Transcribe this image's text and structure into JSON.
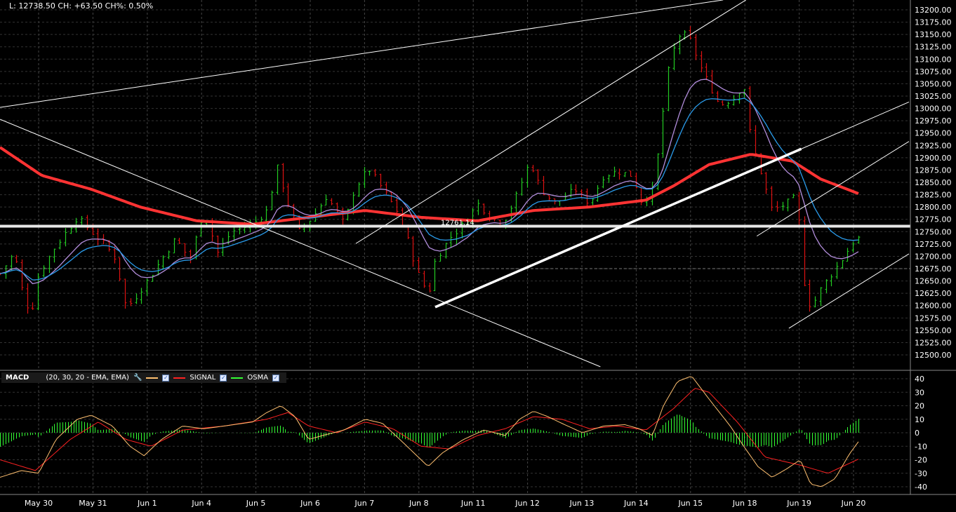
{
  "header": {
    "info": "L: 12738.50 CH: +63.50 CH%: 0.50%"
  },
  "macd_legend": {
    "title": "MACD",
    "params": "(20, 30, 20 - EMA, EMA)",
    "signal_label": "SIGNAL",
    "osma_label": "OSMA",
    "checked": "✓"
  },
  "colors": {
    "background": "#000000",
    "up": "#22cc22",
    "down": "#dd1111",
    "ma_long": "#ff3333",
    "ma_fast": "#b28ddb",
    "ma_slow": "#2a9bea",
    "macd": "#ffc070",
    "signal": "#ff2222",
    "osma": "#33ff33",
    "trendline": "#ffffff"
  },
  "chart_data": [
    {
      "type": "candlestick",
      "x_tick_labels": [
        "May 30",
        "May 31",
        "Jun 1",
        "Jun 4",
        "Jun 5",
        "Jun 6",
        "Jun 7",
        "Jun 8",
        "Jun 11",
        "Jun 12",
        "Jun 13",
        "Jun 14",
        "Jun 15",
        "Jun 18",
        "Jun 19",
        "Jun 20"
      ],
      "y_tick_labels": [
        "13200.00",
        "13175.00",
        "13150.00",
        "13125.00",
        "13100.00",
        "13075.00",
        "13050.00",
        "13025.00",
        "13000.00",
        "12975.00",
        "12950.00",
        "12925.00",
        "12900.00",
        "12875.00",
        "12850.00",
        "12825.00",
        "12800.00",
        "12775.00",
        "12750.00",
        "12725.00",
        "12700.00",
        "12675.00",
        "12650.00",
        "12625.00",
        "12600.00",
        "12575.00",
        "12550.00",
        "12525.00",
        "12500.00"
      ],
      "ylim": [
        12490,
        13220
      ],
      "close_path": [
        [
          -0.71,
          12665
        ],
        [
          -0.45,
          12708
        ],
        [
          -0.26,
          12608
        ],
        [
          -0.13,
          12587
        ],
        [
          0,
          12665
        ],
        [
          0.32,
          12722
        ],
        [
          0.71,
          12779
        ],
        [
          0.97,
          12750
        ],
        [
          1.23,
          12722
        ],
        [
          1.42,
          12694
        ],
        [
          1.61,
          12594
        ],
        [
          1.81,
          12622
        ],
        [
          2.0,
          12651
        ],
        [
          2.26,
          12694
        ],
        [
          2.52,
          12736
        ],
        [
          2.78,
          12694
        ],
        [
          3.04,
          12793
        ],
        [
          3.29,
          12708
        ],
        [
          3.55,
          12750
        ],
        [
          3.94,
          12765
        ],
        [
          4.2,
          12793
        ],
        [
          4.39,
          12879
        ],
        [
          4.59,
          12807
        ],
        [
          4.78,
          12750
        ],
        [
          5.04,
          12779
        ],
        [
          5.3,
          12822
        ],
        [
          5.62,
          12765
        ],
        [
          5.81,
          12836
        ],
        [
          6.07,
          12879
        ],
        [
          6.33,
          12836
        ],
        [
          6.59,
          12793
        ],
        [
          6.78,
          12736
        ],
        [
          6.98,
          12665
        ],
        [
          7.17,
          12622
        ],
        [
          7.3,
          12694
        ],
        [
          7.56,
          12736
        ],
        [
          7.82,
          12765
        ],
        [
          8.08,
          12807
        ],
        [
          8.33,
          12779
        ],
        [
          8.53,
          12765
        ],
        [
          8.79,
          12822
        ],
        [
          9.04,
          12893
        ],
        [
          9.24,
          12836
        ],
        [
          9.5,
          12807
        ],
        [
          9.88,
          12836
        ],
        [
          10.14,
          12807
        ],
        [
          10.4,
          12864
        ],
        [
          10.66,
          12872
        ],
        [
          10.92,
          12864
        ],
        [
          11.11,
          12807
        ],
        [
          11.3,
          12836
        ],
        [
          11.43,
          12935
        ],
        [
          11.56,
          13063
        ],
        [
          11.69,
          13120
        ],
        [
          11.82,
          13156
        ],
        [
          12.02,
          13135
        ],
        [
          12.14,
          13092
        ],
        [
          12.34,
          13049
        ],
        [
          12.53,
          13006
        ],
        [
          12.79,
          13021
        ],
        [
          12.98,
          13049
        ],
        [
          13.11,
          12935
        ],
        [
          13.31,
          12864
        ],
        [
          13.5,
          12793
        ],
        [
          13.76,
          12807
        ],
        [
          13.95,
          12822
        ],
        [
          14.08,
          12651
        ],
        [
          14.21,
          12594
        ],
        [
          14.41,
          12637
        ],
        [
          14.6,
          12665
        ],
        [
          14.79,
          12694
        ],
        [
          14.99,
          12729
        ],
        [
          15.12,
          12739
        ]
      ],
      "ma_long_path": [
        [
          -0.71,
          12921
        ],
        [
          0.06,
          12864
        ],
        [
          0.97,
          12836
        ],
        [
          1.87,
          12800
        ],
        [
          2.91,
          12772
        ],
        [
          3.94,
          12765
        ],
        [
          4.97,
          12779
        ],
        [
          6.01,
          12793
        ],
        [
          7.04,
          12779
        ],
        [
          8.08,
          12772
        ],
        [
          9.11,
          12793
        ],
        [
          10.14,
          12800
        ],
        [
          11.18,
          12814
        ],
        [
          11.69,
          12843
        ],
        [
          12.34,
          12886
        ],
        [
          13.11,
          12907
        ],
        [
          13.88,
          12893
        ],
        [
          14.39,
          12857
        ],
        [
          15.12,
          12826
        ]
      ],
      "horizontal_line": {
        "price": 12761.14,
        "label": "12761.14"
      },
      "reference_line": 12675,
      "trendlines": [
        {
          "from": [
            -0.71,
            13002
          ],
          "to": [
            12.6,
            13220
          ],
          "weight": "thin"
        },
        {
          "from": [
            -0.71,
            12978
          ],
          "to": [
            10.34,
            12476
          ],
          "weight": "thin"
        },
        {
          "from": [
            5.84,
            12726
          ],
          "to": [
            13.02,
            13220
          ],
          "weight": "thin"
        },
        {
          "from": [
            7.3,
            12597
          ],
          "to": [
            14.04,
            12918
          ],
          "weight": "thick"
        },
        {
          "from": [
            14.04,
            12918
          ],
          "to": [
            16.02,
            13013
          ],
          "weight": "thin"
        },
        {
          "from": [
            13.22,
            12741
          ],
          "to": [
            16.02,
            12933
          ],
          "weight": "thin"
        },
        {
          "from": [
            13.81,
            12554
          ],
          "to": [
            16.02,
            12705
          ],
          "weight": "thin"
        }
      ]
    },
    {
      "type": "line",
      "series_names": [
        "MACD",
        "SIGNAL",
        "OSMA"
      ],
      "y_tick_labels": [
        "40",
        "30",
        "20",
        "10",
        "0",
        "-10",
        "-20",
        "-30",
        "-40"
      ],
      "ylim": [
        -45,
        45
      ],
      "macd_path": [
        [
          -0.71,
          -33
        ],
        [
          -0.32,
          -28
        ],
        [
          0,
          -30
        ],
        [
          0.32,
          -5
        ],
        [
          0.71,
          10
        ],
        [
          0.97,
          13
        ],
        [
          1.36,
          5
        ],
        [
          1.68,
          -10
        ],
        [
          1.94,
          -17
        ],
        [
          2.26,
          -5
        ],
        [
          2.65,
          5
        ],
        [
          3.04,
          3
        ],
        [
          3.42,
          5
        ],
        [
          3.94,
          8
        ],
        [
          4.2,
          15
        ],
        [
          4.46,
          20
        ],
        [
          4.72,
          12
        ],
        [
          4.97,
          -5
        ],
        [
          5.23,
          -2
        ],
        [
          5.62,
          2
        ],
        [
          6.01,
          10
        ],
        [
          6.33,
          7
        ],
        [
          6.65,
          -5
        ],
        [
          6.91,
          -15
        ],
        [
          7.17,
          -25
        ],
        [
          7.43,
          -15
        ],
        [
          7.82,
          -5
        ],
        [
          8.2,
          2
        ],
        [
          8.59,
          -2
        ],
        [
          8.85,
          10
        ],
        [
          9.11,
          16
        ],
        [
          9.37,
          12
        ],
        [
          9.63,
          7
        ],
        [
          10.01,
          0
        ],
        [
          10.4,
          5
        ],
        [
          10.79,
          6
        ],
        [
          11.05,
          3
        ],
        [
          11.3,
          -2
        ],
        [
          11.5,
          20
        ],
        [
          11.76,
          38
        ],
        [
          12.02,
          42
        ],
        [
          12.34,
          25
        ],
        [
          12.73,
          5
        ],
        [
          12.98,
          -10
        ],
        [
          13.24,
          -25
        ],
        [
          13.5,
          -33
        ],
        [
          13.76,
          -27
        ],
        [
          14.02,
          -20
        ],
        [
          14.21,
          -38
        ],
        [
          14.41,
          -40
        ],
        [
          14.66,
          -34
        ],
        [
          14.92,
          -16
        ],
        [
          15.12,
          -5
        ]
      ],
      "signal_path": [
        [
          -0.71,
          -20
        ],
        [
          -0.06,
          -28
        ],
        [
          0.58,
          -5
        ],
        [
          1.1,
          8
        ],
        [
          1.61,
          -5
        ],
        [
          2.07,
          -10
        ],
        [
          2.65,
          2
        ],
        [
          3.42,
          5
        ],
        [
          4.2,
          10
        ],
        [
          4.59,
          15
        ],
        [
          4.97,
          5
        ],
        [
          5.49,
          0
        ],
        [
          6.01,
          8
        ],
        [
          6.52,
          3
        ],
        [
          7.04,
          -10
        ],
        [
          7.56,
          -12
        ],
        [
          8.08,
          -2
        ],
        [
          8.59,
          3
        ],
        [
          9.11,
          12
        ],
        [
          9.63,
          10
        ],
        [
          10.14,
          3
        ],
        [
          10.66,
          5
        ],
        [
          11.18,
          2
        ],
        [
          11.69,
          18
        ],
        [
          12.08,
          33
        ],
        [
          12.34,
          30
        ],
        [
          12.86,
          8
        ],
        [
          13.37,
          -18
        ],
        [
          14.02,
          -24
        ],
        [
          14.53,
          -30
        ],
        [
          15.12,
          -19
        ]
      ]
    }
  ]
}
